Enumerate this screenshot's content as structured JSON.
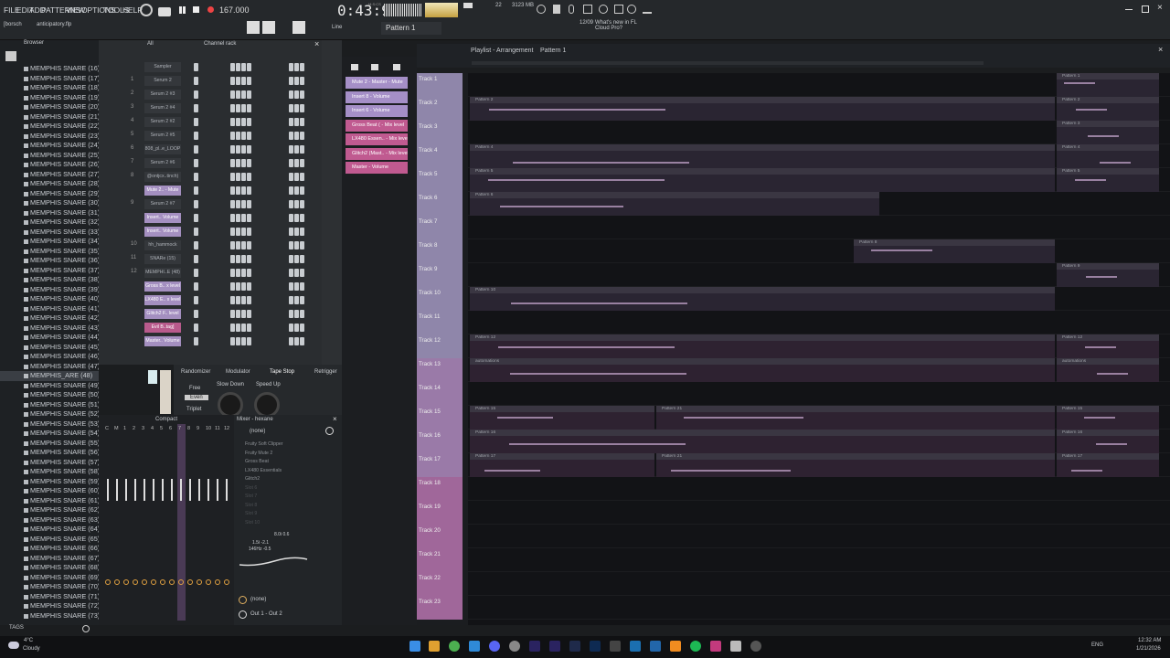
{
  "menu": {
    "file": "FILE",
    "edit": "EDIT",
    "add": "ADD",
    "patterns": "PATTERNS",
    "view": "VIEW",
    "options": "OPTIONS",
    "tools": "TOOLS",
    "help": "HELP"
  },
  "transport": {
    "tempo": "167.000",
    "time": "0:43:90",
    "time_label": "M:S:CS",
    "pattern": "Pattern 1",
    "memory": "3123 MB",
    "voices": "22",
    "news": "What's new in FL Cloud Pro?",
    "news_date": "12/09",
    "snap": "Line"
  },
  "project": {
    "file": "anticipatory.flp",
    "user": "[borsch"
  },
  "browser": {
    "title": "Browser",
    "tab_all": "All",
    "tags": "TAGS",
    "items": [
      "MEMPHIS SNARE (16)",
      "MEMPHIS SNARE (17)",
      "MEMPHIS SNARE (18)",
      "MEMPHIS SNARE (19)",
      "MEMPHIS SNARE (20)",
      "MEMPHIS SNARE (21)",
      "MEMPHIS SNARE (22)",
      "MEMPHIS SNARE (23)",
      "MEMPHIS SNARE (24)",
      "MEMPHIS SNARE (25)",
      "MEMPHIS SNARE (26)",
      "MEMPHIS SNARE (27)",
      "MEMPHIS SNARE (28)",
      "MEMPHIS SNARE (29)",
      "MEMPHIS SNARE (30)",
      "MEMPHIS SNARE (31)",
      "MEMPHIS SNARE (32)",
      "MEMPHIS SNARE (33)",
      "MEMPHIS SNARE (34)",
      "MEMPHIS SNARE (35)",
      "MEMPHIS SNARE (36)",
      "MEMPHIS SNARE (37)",
      "MEMPHIS SNARE (38)",
      "MEMPHIS SNARE (39)",
      "MEMPHIS SNARE (40)",
      "MEMPHIS SNARE (41)",
      "MEMPHIS SNARE (42)",
      "MEMPHIS SNARE (43)",
      "MEMPHIS SNARE (44)",
      "MEMPHIS SNARE (45)",
      "MEMPHIS SNARE (46)",
      "MEMPHIS SNARE (47)",
      "MEMPHIS_ARE (48)",
      "MEMPHIS SNARE (49)",
      "MEMPHIS SNARE (50)",
      "MEMPHIS SNARE (51)",
      "MEMPHIS SNARE (52)",
      "MEMPHIS SNARE (53)",
      "MEMPHIS SNARE (54)",
      "MEMPHIS SNARE (55)",
      "MEMPHIS SNARE (56)",
      "MEMPHIS SNARE (57)",
      "MEMPHIS SNARE (58)",
      "MEMPHIS SNARE (59)",
      "MEMPHIS SNARE (60)",
      "MEMPHIS SNARE (61)",
      "MEMPHIS SNARE (62)",
      "MEMPHIS SNARE (63)",
      "MEMPHIS SNARE (64)",
      "MEMPHIS SNARE (65)",
      "MEMPHIS SNARE (66)",
      "MEMPHIS SNARE (67)",
      "MEMPHIS SNARE (68)",
      "MEMPHIS SNARE (69)",
      "MEMPHIS SNARE (70)",
      "MEMPHIS SNARE (71)",
      "MEMPHIS SNARE (72)",
      "MEMPHIS SNARE (73)"
    ]
  },
  "channel_rack": {
    "title": "Channel rack",
    "channels": [
      {
        "num": "",
        "name": "Sampler",
        "style": ""
      },
      {
        "num": "1",
        "name": "Serum 2",
        "style": ""
      },
      {
        "num": "2",
        "name": "Serum 2 #3",
        "style": ""
      },
      {
        "num": "3",
        "name": "Serum 2 #4",
        "style": ""
      },
      {
        "num": "4",
        "name": "Serum 2 #2",
        "style": ""
      },
      {
        "num": "5",
        "name": "Serum 2 #5",
        "style": ""
      },
      {
        "num": "6",
        "name": "808_pl..e_LOOP",
        "style": ""
      },
      {
        "num": "7",
        "name": "Serum 2 #6",
        "style": ""
      },
      {
        "num": "8",
        "name": "@ontjcx..tinch)",
        "style": ""
      },
      {
        "num": "",
        "name": "Mute 2.. - Mute",
        "style": "hl"
      },
      {
        "num": "9",
        "name": "Serum 2 #7",
        "style": ""
      },
      {
        "num": "",
        "name": "Insert.. Volume",
        "style": "hl"
      },
      {
        "num": "",
        "name": "Insert.. Volume",
        "style": "hl"
      },
      {
        "num": "10",
        "name": "hh_hammock",
        "style": ""
      },
      {
        "num": "11",
        "name": "SNARe (15)",
        "style": ""
      },
      {
        "num": "12",
        "name": "MEMPHI..E (48)",
        "style": ""
      },
      {
        "num": "",
        "name": "Gross B.. x level",
        "style": "hl"
      },
      {
        "num": "",
        "name": "LX480 E.. x level",
        "style": "hl"
      },
      {
        "num": "",
        "name": "Glitch2 F.. level",
        "style": "hl"
      },
      {
        "num": "",
        "name": "Evil B..tag]",
        "style": "pk"
      },
      {
        "num": "",
        "name": "Master.. Volume",
        "style": "hl"
      }
    ]
  },
  "fx_tabs": {
    "randomizer": "Randomizer",
    "modulator": "Modulator",
    "tape_stop": "Tape Stop",
    "retrigger": "Retrigger",
    "slow_down": "Slow Down",
    "speed_up": "Speed Up",
    "free": "Free",
    "even": "Even",
    "triplet": "Triplet"
  },
  "mixer": {
    "title": "Compact",
    "panel_title": "Mixer - hexane",
    "preset": "(none)",
    "output": "Out 1 - Out 2",
    "input": "(none)",
    "slots": [
      "Fruity Soft Clipper",
      "Fruity Mute 2",
      "Gross Beat",
      "LX480 Essentials",
      "Glitch2",
      "Slot 6",
      "Slot 7",
      "Slot 8",
      "Slot 9",
      "Slot 10"
    ],
    "eq_readout": [
      "8.0i 0.6",
      "1.5i -2.1",
      "146Hz -0.5"
    ],
    "channel_nums": [
      "C",
      "M",
      "1",
      "2",
      "3",
      "4",
      "5",
      "6",
      "7",
      "8",
      "9",
      "10",
      "11",
      "12"
    ]
  },
  "automation_clips": [
    "Mute 2 - Master - Mute",
    "Insert 8 - Volume",
    "Insert 6 - Volume",
    "Gross Beat ( - Mix level",
    "LX480 Essen.. - Mix level",
    "Glitch2 (Mast.. - Mix level",
    "Master - Volume"
  ],
  "playlist": {
    "title": "Playlist - Arrangement",
    "pattern": "Pattern 1",
    "tracks": [
      "Track 1",
      "Track 2",
      "Track 3",
      "Track 4",
      "Track 5",
      "Track 6",
      "Track 7",
      "Track 8",
      "Track 9",
      "Track 10",
      "Track 11",
      "Track 12",
      "Track 13",
      "Track 14",
      "Track 15",
      "Track 16",
      "Track 17",
      "Track 18",
      "Track 19",
      "Track 20",
      "Track 21",
      "Track 22",
      "Track 23"
    ],
    "clip_labels": {
      "p2": "Pattern 2",
      "p3": "Pattern 3",
      "p4": "Pattern 4",
      "p5": "Pattern 5",
      "p6": "Pattern 6",
      "p8": "Pattern 8",
      "p9": "Pattern 9",
      "p10": "Pattern 10",
      "p12": "Pattern 12",
      "p13": "automations",
      "p15": "Pattern 15",
      "p16": "Pattern 16",
      "p17": "Pattern 17",
      "p21": "Pattern 21",
      "p1": "Pattern 1"
    }
  },
  "taskbar": {
    "weather_temp": "4°C",
    "weather_text": "Cloudy",
    "lang": "ENG",
    "time": "12:32 AM",
    "date": "1/21/2026"
  },
  "colors": {
    "accent": "#a58fc7",
    "pink": "#c05a90",
    "track_label": "#a0a0c0"
  }
}
